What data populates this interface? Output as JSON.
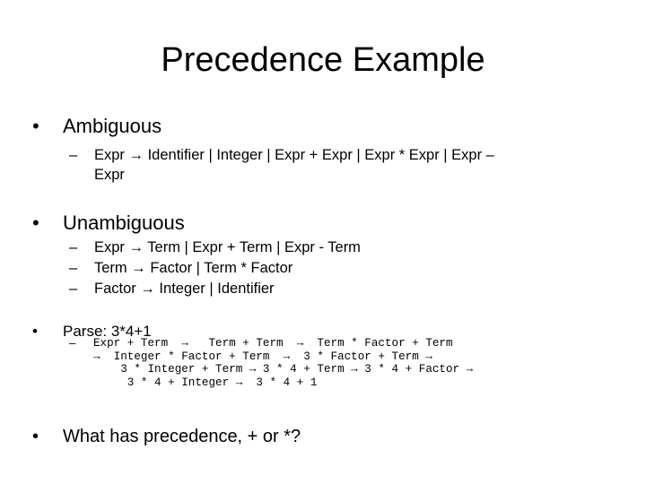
{
  "slide": {
    "title": "Precedence Example",
    "arrow_glyph": "→",
    "bullets": [
      {
        "label": "Ambiguous",
        "subitems": [
          {
            "line1": "Expr → Identifier  |  Integer | Expr + Expr | Expr * Expr  |  Expr –",
            "line2": "Expr"
          }
        ]
      },
      {
        "label": "Unambiguous",
        "subitems": [
          {
            "text": "Expr → Term   |  Expr  +  Term   |  Expr - Term"
          },
          {
            "text": "Term → Factor  |  Term   *  Factor"
          },
          {
            "text": "Factor →  Integer   |  Identifier"
          }
        ]
      },
      {
        "label": "Parse:  3*4+1",
        "derivation_lines": [
          "Expr + Term  →   Term + Term  →  Term * Factor + Term",
          "→  Integer * Factor + Term  →  3 * Factor + Term →",
          "    3 * Integer + Term → 3 * 4 + Term → 3 * 4 + Factor →",
          "     3 * 4 + Integer →  3 * 4 + 1"
        ]
      },
      {
        "label": "What has precedence, + or *?"
      }
    ],
    "bullet_glyph": "•",
    "dash_glyph": "–"
  }
}
